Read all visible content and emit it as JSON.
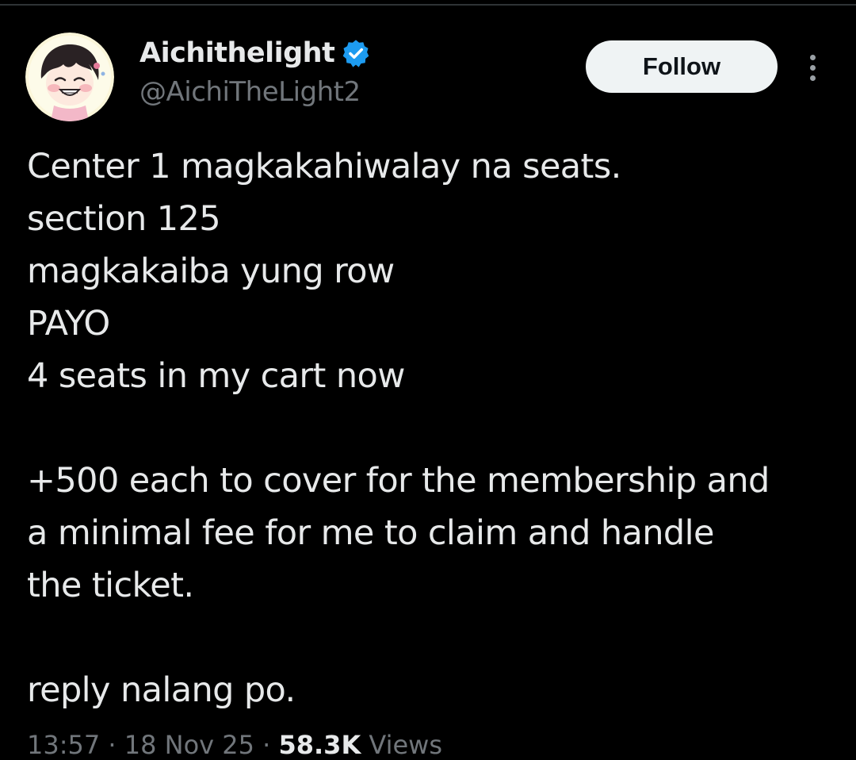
{
  "tweet": {
    "author": {
      "display_name": "Aichithelight",
      "handle": "@AichiTheLight2",
      "verified": true,
      "verified_color": "#1d9bf0"
    },
    "follow_label": "Follow",
    "more_icon": "more-vertical-icon",
    "text_lines": [
      "Center 1 magkakahiwalay na seats.",
      "section 125",
      "magkakaiba yung row",
      "PAYO",
      "4 seats in my cart now",
      "",
      "+500 each to cover for the membership and",
      "a minimal fee for me to claim and handle",
      "the ticket.",
      "",
      "reply nalang po."
    ],
    "meta": {
      "time": "13:57",
      "separator": "·",
      "date": "18 Nov 25",
      "views_count": "58.3K",
      "views_label": "Views"
    }
  },
  "colors": {
    "background": "#000000",
    "text": "#e7e9ea",
    "secondary_text": "#71767b",
    "button_bg": "#eff3f4",
    "button_text": "#0f1419"
  }
}
